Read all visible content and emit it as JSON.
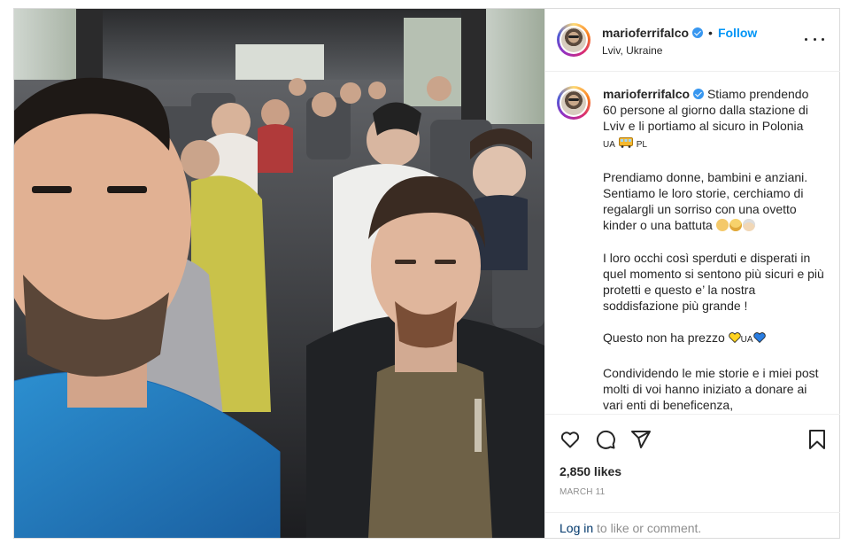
{
  "post": {
    "username": "marioferrifalco",
    "follow_label": "Follow",
    "dot": "•",
    "location": "Lviv, Ukraine",
    "caption": {
      "p1": "Stiamo prendendo 60 persone al giorno dalla stazione di Lviv e li portiamo al sicuro in Polonia",
      "flag_from": "UA",
      "flag_to": "PL",
      "p2": "Prendiamo donne, bambini e anziani. Sentiamo le loro storie, cerchiamo di regalargli un sorriso con una ovetto kinder o una battuta",
      "p3": "I loro occhi così sperduti e disperati in quel momento si sentono più sicuri e più protetti e questo e’ la nostra soddisfazione più grande !",
      "p4": "Questo non ha prezzo",
      "p4_flag": "UA",
      "p5": "Condividendo le mie storie e i miei post molti di voi hanno iniziato a donare ai vari enti di beneficenza,"
    },
    "likes": "2,850 likes",
    "date": "MARCH 11",
    "login_link": "Log in",
    "login_suffix": " to like or comment."
  },
  "icons": {
    "more": "more-options-icon",
    "like": "heart-icon",
    "comment": "comment-icon",
    "share": "share-icon",
    "save": "bookmark-icon",
    "verified": "verified-badge-icon"
  },
  "colors": {
    "link_blue": "#0095f6",
    "verified_blue": "#3897f0",
    "muted": "#8e8e8e",
    "border": "#dbdbdb"
  }
}
